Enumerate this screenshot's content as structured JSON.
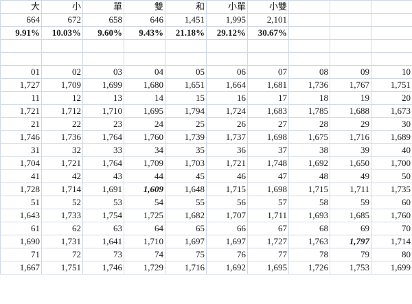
{
  "summary": {
    "headers": [
      "大",
      "小",
      "單",
      "雙",
      "和",
      "小單",
      "小雙"
    ],
    "counts": [
      "664",
      "672",
      "658",
      "646",
      "1,451",
      "1,995",
      "2,101"
    ],
    "percents": [
      "9.91%",
      "10.03%",
      "9.60%",
      "9.43%",
      "21.18%",
      "29.12%",
      "30.67%"
    ]
  },
  "number_rows": [
    {
      "numbers": [
        "01",
        "02",
        "03",
        "04",
        "05",
        "06",
        "07",
        "08",
        "09",
        "10"
      ],
      "values": [
        "1,727",
        "1,709",
        "1,699",
        "1,680",
        "1,651",
        "1,664",
        "1,681",
        "1,736",
        "1,767",
        "1,751"
      ]
    },
    {
      "numbers": [
        "11",
        "12",
        "13",
        "14",
        "15",
        "16",
        "17",
        "18",
        "19",
        "20"
      ],
      "values": [
        "1,721",
        "1,712",
        "1,710",
        "1,695",
        "1,794",
        "1,724",
        "1,683",
        "1,785",
        "1,688",
        "1,673"
      ]
    },
    {
      "numbers": [
        "21",
        "22",
        "23",
        "24",
        "25",
        "26",
        "27",
        "28",
        "29",
        "30"
      ],
      "values": [
        "1,746",
        "1,736",
        "1,764",
        "1,760",
        "1,739",
        "1,737",
        "1,698",
        "1,675",
        "1,716",
        "1,689"
      ]
    },
    {
      "numbers": [
        "31",
        "32",
        "33",
        "34",
        "35",
        "36",
        "37",
        "38",
        "39",
        "40"
      ],
      "values": [
        "1,704",
        "1,721",
        "1,764",
        "1,709",
        "1,703",
        "1,721",
        "1,748",
        "1,692",
        "1,650",
        "1,700"
      ]
    },
    {
      "numbers": [
        "41",
        "42",
        "43",
        "44",
        "45",
        "46",
        "47",
        "48",
        "49",
        "50"
      ],
      "values": [
        "1,728",
        "1,714",
        "1,691",
        "1,609",
        "1,648",
        "1,715",
        "1,698",
        "1,715",
        "1,711",
        "1,735"
      ]
    },
    {
      "numbers": [
        "51",
        "52",
        "53",
        "54",
        "55",
        "56",
        "57",
        "58",
        "59",
        "60"
      ],
      "values": [
        "1,643",
        "1,733",
        "1,754",
        "1,725",
        "1,682",
        "1,707",
        "1,711",
        "1,693",
        "1,685",
        "1,760"
      ]
    },
    {
      "numbers": [
        "61",
        "62",
        "63",
        "64",
        "65",
        "66",
        "67",
        "68",
        "69",
        "70"
      ],
      "values": [
        "1,690",
        "1,731",
        "1,641",
        "1,710",
        "1,697",
        "1,697",
        "1,727",
        "1,763",
        "1,797",
        "1,714"
      ]
    },
    {
      "numbers": [
        "71",
        "72",
        "73",
        "74",
        "75",
        "76",
        "77",
        "78",
        "79",
        "80"
      ],
      "values": [
        "1,667",
        "1,751",
        "1,746",
        "1,729",
        "1,716",
        "1,692",
        "1,695",
        "1,726",
        "1,753",
        "1,699"
      ]
    }
  ],
  "highlights": {
    "min": {
      "number": "44",
      "value": "1,609",
      "color": "#1f7a1f"
    },
    "max": {
      "number": "69",
      "value": "1,797",
      "color": "#c01818"
    }
  },
  "colors": {
    "number_text": "#1a2eb8",
    "percent_text": "#8b1a1a",
    "gridline": "#d0d7e5"
  }
}
